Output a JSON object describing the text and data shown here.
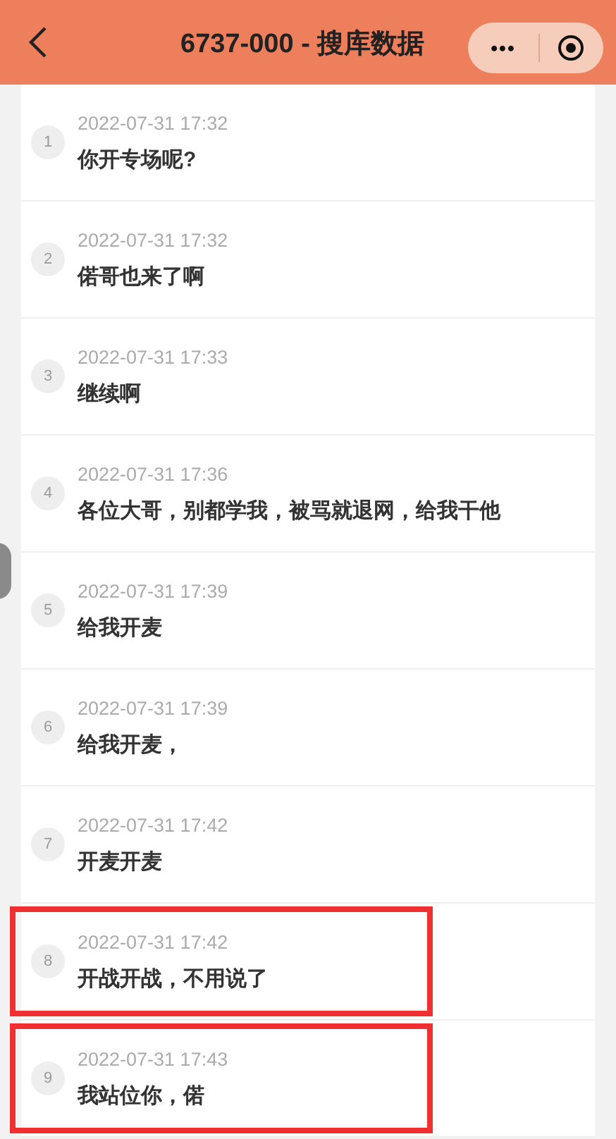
{
  "header": {
    "title": "6737-000 - 搜库数据",
    "more": "•••"
  },
  "messages": [
    {
      "index": "1",
      "time": "2022-07-31 17:32",
      "text": "你开专场呢?",
      "highlighted": false
    },
    {
      "index": "2",
      "time": "2022-07-31 17:32",
      "text": "偌哥也来了啊",
      "highlighted": false
    },
    {
      "index": "3",
      "time": "2022-07-31 17:33",
      "text": "继续啊",
      "highlighted": false
    },
    {
      "index": "4",
      "time": "2022-07-31 17:36",
      "text": "各位大哥，别都学我，被骂就退网，给我干他",
      "highlighted": false
    },
    {
      "index": "5",
      "time": "2022-07-31 17:39",
      "text": "给我开麦",
      "highlighted": false
    },
    {
      "index": "6",
      "time": "2022-07-31 17:39",
      "text": "给我开麦，",
      "highlighted": false
    },
    {
      "index": "7",
      "time": "2022-07-31 17:42",
      "text": "开麦开麦",
      "highlighted": false
    },
    {
      "index": "8",
      "time": "2022-07-31 17:42",
      "text": "开战开战，不用说了",
      "highlighted": true
    },
    {
      "index": "9",
      "time": "2022-07-31 17:43",
      "text": "我站位你，偌",
      "highlighted": true
    }
  ]
}
